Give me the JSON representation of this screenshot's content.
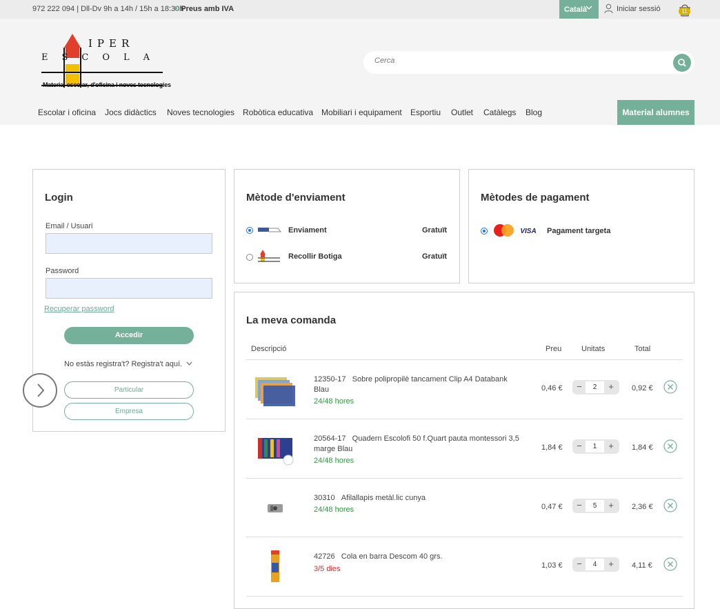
{
  "topbar": {
    "contact": "972 222 094 | Dll-Dv 9h a 14h / 15h a 18:30h",
    "iva_symbol": "€",
    "iva_label": "Preus amb IVA",
    "language": "Català",
    "login": "Iniciar sessió",
    "cart_count": "11"
  },
  "logo": {
    "line1": "IPER",
    "line2": "ESCOLA",
    "tagline": "Material escolar, d'oficina i noves tecnologies"
  },
  "search": {
    "placeholder": "Cerca"
  },
  "nav": {
    "items": [
      "Escolar i oficina",
      "Jocs didàctics",
      "Noves tecnologies",
      "Robòtica educativa",
      "Mobiliari i equipament",
      "Esportiu",
      "Outlet",
      "Catàlegs",
      "Blog"
    ],
    "material_button": "Material alumnes"
  },
  "login_panel": {
    "title": "Login",
    "email_label": "Email / Usuari",
    "password_label": "Password",
    "recover": "Recuperar password",
    "submit": "Accedir",
    "register_prompt": "No estàs registra't? Registra't aquí.",
    "particular": "Particular",
    "empresa": "Empresa"
  },
  "shipping": {
    "title": "Mètode d'enviament",
    "options": [
      {
        "label": "Enviament",
        "price": "Gratuït",
        "selected": true
      },
      {
        "label": "Recollir Botiga",
        "price": "Gratuït",
        "selected": false
      }
    ]
  },
  "payment": {
    "title": "Mètodes de pagament",
    "option": "Pagament targeta",
    "selected": true
  },
  "order": {
    "title": "La meva comanda",
    "headers": {
      "description": "Descripció",
      "price": "Preu",
      "units": "Unitats",
      "total": "Total"
    },
    "items": [
      {
        "code": "12350-17",
        "name": "Sobre polipropilè tancament Clip A4 Databank Blau",
        "availability": "24/48 hores",
        "avail_color": "#2a9a3c",
        "price": "0,46 €",
        "qty": "2",
        "total": "0,92 €"
      },
      {
        "code": "20564-17",
        "name": "Quadern Escolofi 50 f.Quart pauta montessori 3,5 marge Blau",
        "availability": "24/48 hores",
        "avail_color": "#2a9a3c",
        "price": "1,84 €",
        "qty": "1",
        "total": "1,84 €"
      },
      {
        "code": "30310",
        "name": "Afilallapis metàl.lic cunya",
        "availability": "24/48 hores",
        "avail_color": "#2a9a3c",
        "price": "0,47 €",
        "qty": "5",
        "total": "2,36 €"
      },
      {
        "code": "42726",
        "name": "Cola en barra Descom 40 grs.",
        "availability": "3/5 dies",
        "avail_color": "#d62b2b",
        "price": "1,03 €",
        "qty": "4",
        "total": "4,11 €"
      }
    ]
  },
  "colors": {
    "accent": "#74b09a",
    "topbar_bg": "#ececec",
    "header_bg": "#f4f4f4"
  }
}
